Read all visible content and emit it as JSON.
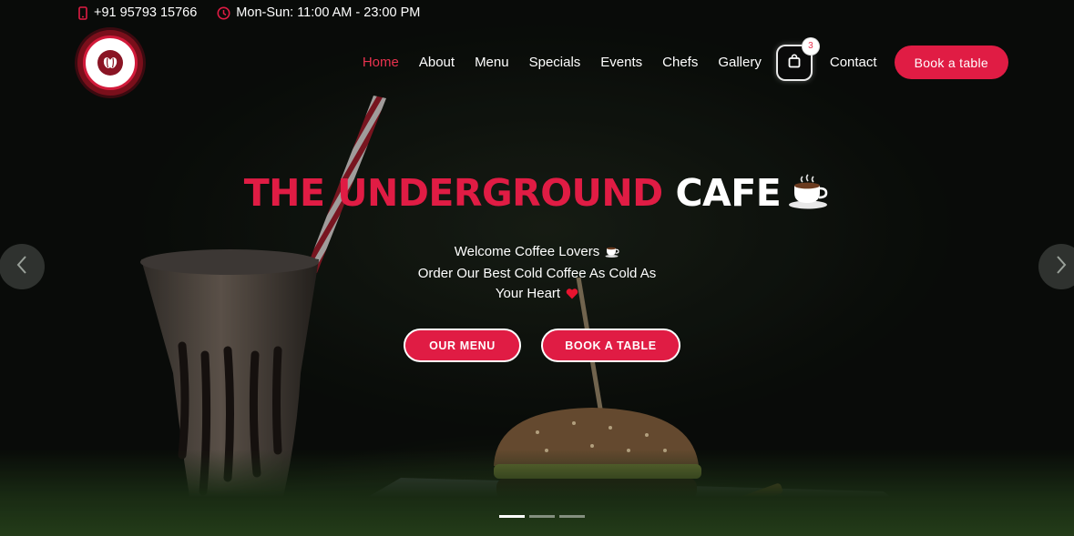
{
  "topbar": {
    "phone": "+91 95793 15766",
    "hours": "Mon-Sun: 11:00 AM - 23:00 PM"
  },
  "logo": {
    "text": "THE UNDERGROUND CAFE",
    "icon": "coffee-beans-icon"
  },
  "nav": {
    "items": [
      {
        "label": "Home",
        "active": true
      },
      {
        "label": "About"
      },
      {
        "label": "Menu"
      },
      {
        "label": "Specials"
      },
      {
        "label": "Events"
      },
      {
        "label": "Chefs"
      },
      {
        "label": "Gallery"
      }
    ],
    "cart_count": "3",
    "contact": "Contact",
    "book_button": "Book a table"
  },
  "hero": {
    "title_red": "THE UNDERGROUND",
    "title_white": "CAFE",
    "title_icon": "coffee-cup-icon",
    "line1": "Welcome Coffee Lovers",
    "line2": "Order Our Best Cold Coffee As Cold As",
    "line3": "Your Heart",
    "menu_button": "OUR MENU",
    "book_button": "BOOK A TABLE"
  },
  "carousel": {
    "slides": 3,
    "active_slide": 1
  },
  "colors": {
    "accent": "#e01c44",
    "active_nav": "#e8324f",
    "text": "#ffffff",
    "background": "#0d100d"
  }
}
